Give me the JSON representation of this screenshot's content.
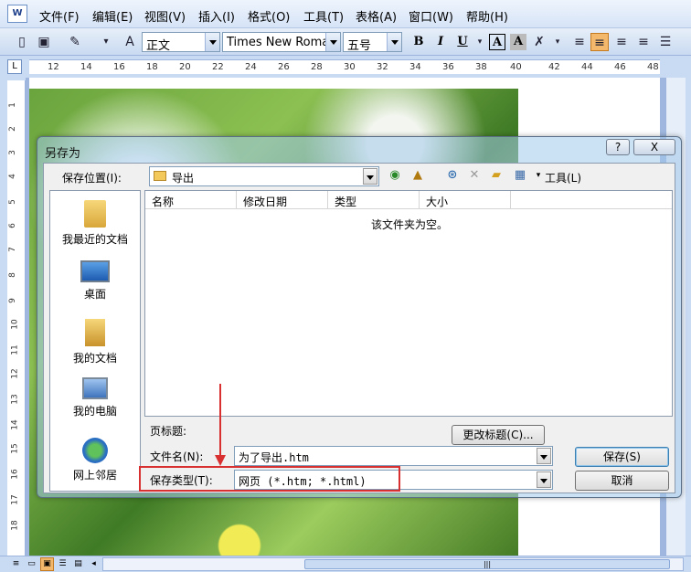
{
  "menu": [
    "文件(F)",
    "编辑(E)",
    "视图(V)",
    "插入(I)",
    "格式(O)",
    "工具(T)",
    "表格(A)",
    "窗口(W)",
    "帮助(H)"
  ],
  "app_icon_label": "W",
  "toolbar": {
    "style_value": "正文",
    "font_value": "Times New Roman",
    "size_value": "五号",
    "bold": "B",
    "italic": "I",
    "underline": "U",
    "char_border": "A",
    "char_shade": "A"
  },
  "ruler": {
    "corner": "L",
    "ticks": [
      "12",
      "14",
      "16",
      "18",
      "20",
      "22",
      "24",
      "26",
      "28",
      "30",
      "32",
      "34",
      "36",
      "38",
      "40",
      "42",
      "44",
      "46",
      "48"
    ],
    "vticks": [
      "1",
      "2",
      "3",
      "4",
      "5",
      "6",
      "7",
      "8",
      "9",
      "10",
      "11",
      "12",
      "13",
      "14",
      "15",
      "16",
      "17",
      "18"
    ]
  },
  "dialog": {
    "title": "另存为",
    "help_btn": "?",
    "close_btn": "X",
    "save_in_label": "保存位置(I):",
    "save_in_value": "导出",
    "tools_label": "工具(L)",
    "places": [
      {
        "label": "我最近的文档",
        "icon": "recent-docs-icon"
      },
      {
        "label": "桌面",
        "icon": "desktop-icon"
      },
      {
        "label": "我的文档",
        "icon": "my-documents-icon"
      },
      {
        "label": "我的电脑",
        "icon": "my-computer-icon"
      },
      {
        "label": "网上邻居",
        "icon": "network-icon"
      }
    ],
    "columns": [
      "名称",
      "修改日期",
      "类型",
      "大小"
    ],
    "empty_message": "该文件夹为空。",
    "page_title_label": "页标题:",
    "change_title_btn": "更改标题(C)...",
    "filename_label": "文件名(N):",
    "filename_value": "为了导出.htm",
    "filetype_label": "保存类型(T):",
    "filetype_value": "网页 (*.htm; *.html)",
    "save_btn": "保存(S)",
    "cancel_btn": "取消"
  },
  "colors": {
    "highlight": "#d83030",
    "accent_orange": "#f3b86c",
    "chrome_blue": "#c9daf3"
  }
}
